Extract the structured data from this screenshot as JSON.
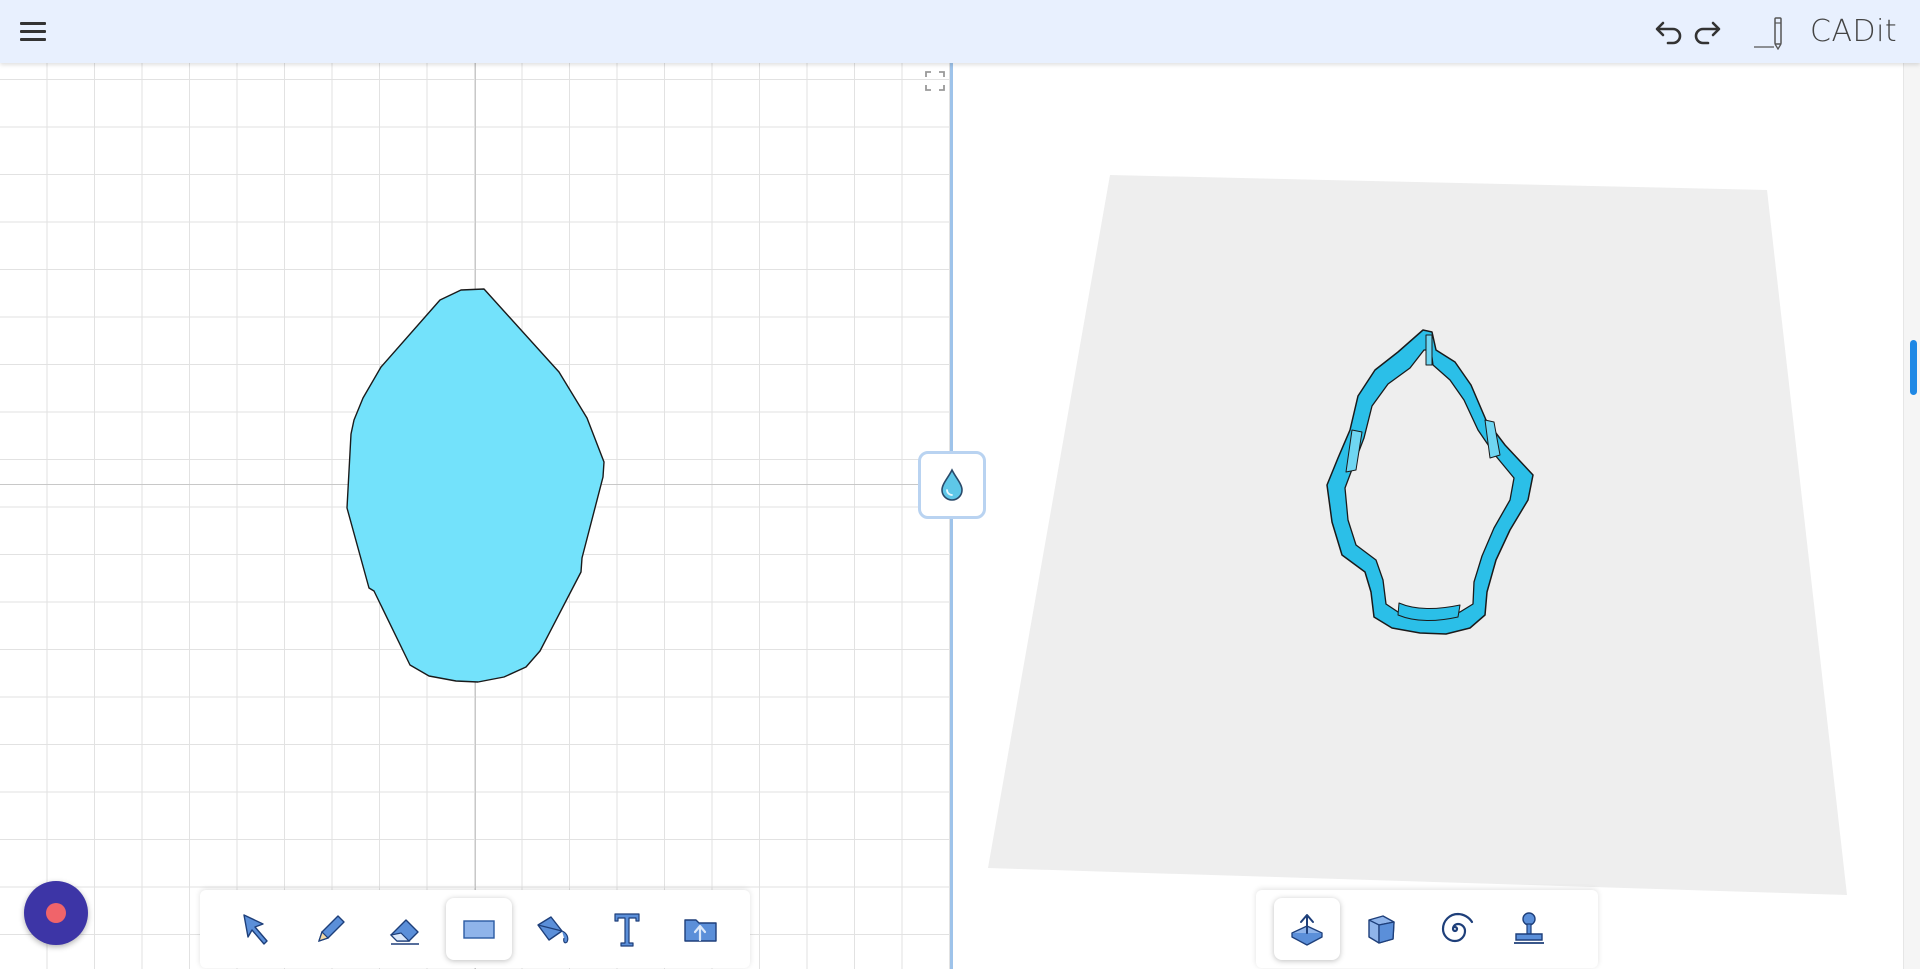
{
  "app": {
    "title": "CADit"
  },
  "colors": {
    "accent": "#1e88e5",
    "shape_fill": "#73e2fb",
    "topbar": "#e8f0fe",
    "record": "#3d35a6"
  },
  "topbar": {
    "menu_icon": "hamburger-menu-icon",
    "undo_icon": "undo-icon",
    "redo_icon": "redo-icon",
    "logo_icon": "pencil-logo-icon"
  },
  "sketch_tools": [
    {
      "name": "select",
      "icon": "cursor-arrow-icon",
      "active": false
    },
    {
      "name": "pencil",
      "icon": "pencil-icon",
      "active": false
    },
    {
      "name": "eraser",
      "icon": "eraser-icon",
      "active": false
    },
    {
      "name": "rectangle",
      "icon": "rectangle-icon",
      "active": true
    },
    {
      "name": "fill",
      "icon": "paint-bucket-icon",
      "active": false
    },
    {
      "name": "text",
      "icon": "text-icon",
      "active": false
    },
    {
      "name": "import",
      "icon": "folder-upload-icon",
      "active": false
    }
  ],
  "model_tools": [
    {
      "name": "export",
      "icon": "export-tray-icon",
      "active": true
    },
    {
      "name": "box",
      "icon": "cube-icon",
      "active": false
    },
    {
      "name": "spiral",
      "icon": "spiral-icon",
      "active": false
    },
    {
      "name": "stamp",
      "icon": "stamp-icon",
      "active": false
    }
  ]
}
